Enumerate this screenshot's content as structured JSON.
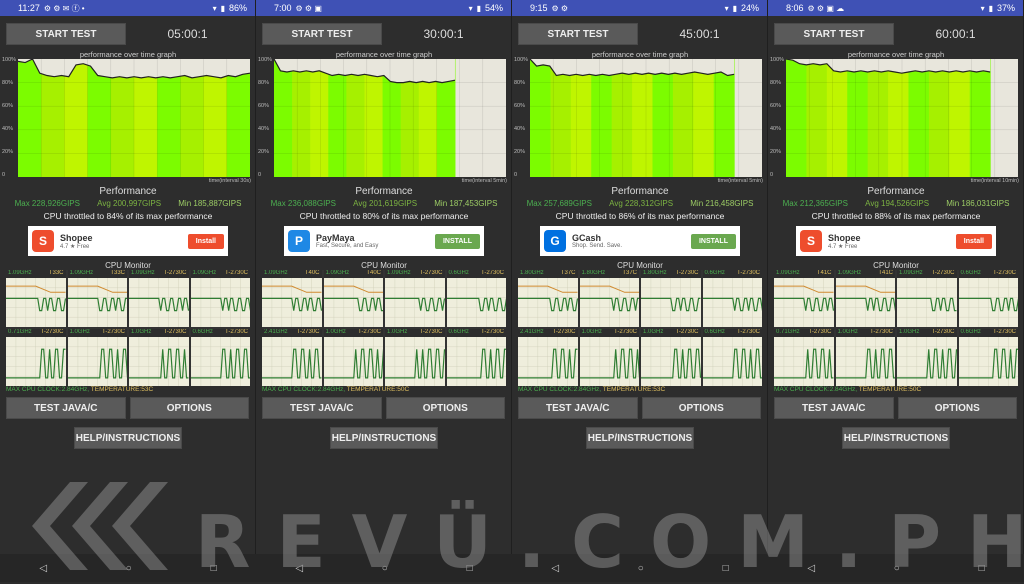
{
  "common": {
    "start_label": "START TEST",
    "graph_title": "performance over time graph",
    "y_ticks": [
      "100%",
      "80%",
      "60%",
      "40%",
      "20%",
      "0"
    ],
    "perf_title": "Performance",
    "cpu_monitor": "CPU Monitor",
    "test_label": "TEST JAVA/C",
    "options_label": "OPTIONS",
    "help_label": "HELP/INSTRUCTIONS",
    "nav": {
      "back": "◁",
      "home": "○",
      "recents": "□"
    }
  },
  "watermark": "REVÜ.COM.PH",
  "panels": [
    {
      "status": {
        "time": "11:27",
        "icons": "⚙ ⚙ ✉ ⓕ •",
        "battery": "86%"
      },
      "timer": "05:00:1",
      "x_label": "time(interval 30s)",
      "max": "Max 228,926GIPS",
      "avg": "Avg 200,997GIPS",
      "min": "Min 185,887GIPS",
      "throttle": "CPU throttled to 84% of its max performance",
      "ad": {
        "name": "Shopee",
        "sub": "4.7 ★ Free",
        "button": "Install",
        "icon": "S",
        "color": "#ee4d2d"
      },
      "cores": [
        {
          "freq": "1.09GHz",
          "temp": "T33C"
        },
        {
          "freq": "1.09GHz",
          "temp": "T33C"
        },
        {
          "freq": "1.09GHz",
          "temp": "T-2730C"
        },
        {
          "freq": "1.09GHz",
          "temp": "T-2730C"
        },
        {
          "freq": "0.71GHz",
          "temp": "T-2730C"
        },
        {
          "freq": "1.0GHz",
          "temp": "T-2730C"
        },
        {
          "freq": "1.0GHz",
          "temp": "T-2730C"
        },
        {
          "freq": "0.6GHz",
          "temp": "T-2730C"
        }
      ],
      "clock": "MAX CPU CLOCK:2.84GHz,",
      "temperature": "TEMPERATURE:53C",
      "perf_series": [
        98,
        97,
        100,
        88,
        86,
        85,
        86,
        85,
        95,
        96,
        94,
        86,
        85,
        84,
        85,
        84,
        85,
        84,
        85,
        84,
        85,
        84,
        85,
        86,
        84,
        85,
        86,
        85,
        84,
        86,
        85,
        87,
        88
      ],
      "fill_fraction": 1.0
    },
    {
      "status": {
        "time": "7:00",
        "icons": "⚙ ⚙ ▣",
        "battery": "54%"
      },
      "timer": "30:00:1",
      "x_label": "time(interval 5min)",
      "max": "Max 236,088GIPS",
      "avg": "Avg 201,619GIPS",
      "min": "Min 187,453GIPS",
      "throttle": "CPU throttled to 80% of its max performance",
      "ad": {
        "name": "PayMaya",
        "sub": "Fast, Secure, and Easy",
        "button": "INSTALL",
        "icon": "P",
        "color": "#1e88e5"
      },
      "cores": [
        {
          "freq": "1.09GHz",
          "temp": "T40C"
        },
        {
          "freq": "1.09GHz",
          "temp": "T40C"
        },
        {
          "freq": "1.09GHz",
          "temp": "T-2730C"
        },
        {
          "freq": "0.6GHz",
          "temp": "T-2730C"
        },
        {
          "freq": "2.41GHz",
          "temp": "T-2730C"
        },
        {
          "freq": "1.0GHz",
          "temp": "T-2730C"
        },
        {
          "freq": "1.0GHz",
          "temp": "T-2730C"
        },
        {
          "freq": "0.6GHz",
          "temp": "T-2730C"
        }
      ],
      "clock": "MAX CPU CLOCK:2.84GHz,",
      "temperature": "TEMPERATURE:50C",
      "perf_series": [
        100,
        90,
        89,
        90,
        89,
        90,
        89,
        90,
        88,
        86,
        87,
        86,
        87,
        86,
        87,
        86,
        85,
        86,
        81,
        80,
        80,
        81,
        80,
        81,
        80,
        81,
        80,
        81,
        82
      ],
      "fill_fraction": 0.78
    },
    {
      "status": {
        "time": "9:15",
        "icons": "⚙ ⚙",
        "battery": "24%"
      },
      "timer": "45:00:1",
      "x_label": "time(interval 5min)",
      "max": "Max 257,689GIPS",
      "avg": "Avg 228,312GIPS",
      "min": "Min 216,458GIPS",
      "throttle": "CPU throttled to 86% of its max performance",
      "ad": {
        "name": "GCash",
        "sub": "Shop. Send. Save.",
        "button": "INSTALL",
        "icon": "G",
        "color": "#0070e0"
      },
      "cores": [
        {
          "freq": "1.80GHz",
          "temp": "T37C"
        },
        {
          "freq": "1.80GHz",
          "temp": "T37C"
        },
        {
          "freq": "1.80GHz",
          "temp": "T-2730C"
        },
        {
          "freq": "0.6GHz",
          "temp": "T-2730C"
        },
        {
          "freq": "2.41GHz",
          "temp": "T-2730C"
        },
        {
          "freq": "1.0GHz",
          "temp": "T-2730C"
        },
        {
          "freq": "1.0GHz",
          "temp": "T-2730C"
        },
        {
          "freq": "0.6GHz",
          "temp": "T-2730C"
        }
      ],
      "clock": "MAX CPU CLOCK:2.84GHz,",
      "temperature": "TEMPERATURE:53C",
      "perf_series": [
        100,
        94,
        95,
        94,
        86,
        87,
        86,
        87,
        86,
        87,
        86,
        87,
        86,
        87,
        88,
        87,
        88,
        87,
        88,
        87,
        88,
        87,
        88,
        87,
        88,
        89,
        88,
        87,
        88,
        89,
        86,
        87
      ],
      "fill_fraction": 0.88
    },
    {
      "status": {
        "time": "8:06",
        "icons": "⚙ ⚙ ▣ ☁",
        "battery": "37%"
      },
      "timer": "60:00:1",
      "x_label": "time(interval 10min)",
      "max": "Max 212,365GIPS",
      "avg": "Avg 194,526GIPS",
      "min": "Min 186,031GIPS",
      "throttle": "CPU throttled to 88% of its max performance",
      "ad": {
        "name": "Shopee",
        "sub": "4.7 ★ Free",
        "button": "Install",
        "icon": "S",
        "color": "#ee4d2d"
      },
      "cores": [
        {
          "freq": "1.09GHz",
          "temp": "T41C"
        },
        {
          "freq": "1.09GHz",
          "temp": "T41C"
        },
        {
          "freq": "1.09GHz",
          "temp": "T-2730C"
        },
        {
          "freq": "0.6GHz",
          "temp": "T-2730C"
        },
        {
          "freq": "0.71GHz",
          "temp": "T-2730C"
        },
        {
          "freq": "1.0GHz",
          "temp": "T-2730C"
        },
        {
          "freq": "1.0GHz",
          "temp": "T-2730C"
        },
        {
          "freq": "0.6GHz",
          "temp": "T-2730C"
        }
      ],
      "clock": "MAX CPU CLOCK:2.84GHz,",
      "temperature": "TEMPERATURE:50C",
      "perf_series": [
        100,
        99,
        96,
        95,
        96,
        95,
        96,
        90,
        89,
        90,
        89,
        90,
        89,
        90,
        89,
        90,
        89,
        88,
        89,
        90,
        89,
        90,
        89,
        90,
        89,
        90,
        89,
        90,
        89,
        90,
        89
      ],
      "fill_fraction": 0.88
    }
  ]
}
